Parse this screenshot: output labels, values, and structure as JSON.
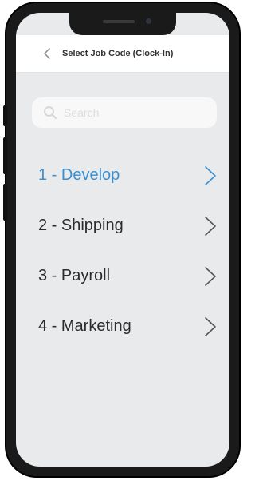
{
  "header": {
    "title": "Select Job Code (Clock-In)",
    "back_icon": "chevron-left-icon"
  },
  "search": {
    "placeholder": "Search",
    "icon": "search-icon"
  },
  "jobs": [
    {
      "label": "1 - Develop",
      "selected": true
    },
    {
      "label": "2 - Shipping",
      "selected": false
    },
    {
      "label": "3 - Payroll",
      "selected": false
    },
    {
      "label": "4 - Marketing",
      "selected": false
    }
  ],
  "colors": {
    "accent": "#3a8fd1",
    "text": "#2b2b2b",
    "background": "#e9eaec",
    "chevron": "#555555"
  }
}
